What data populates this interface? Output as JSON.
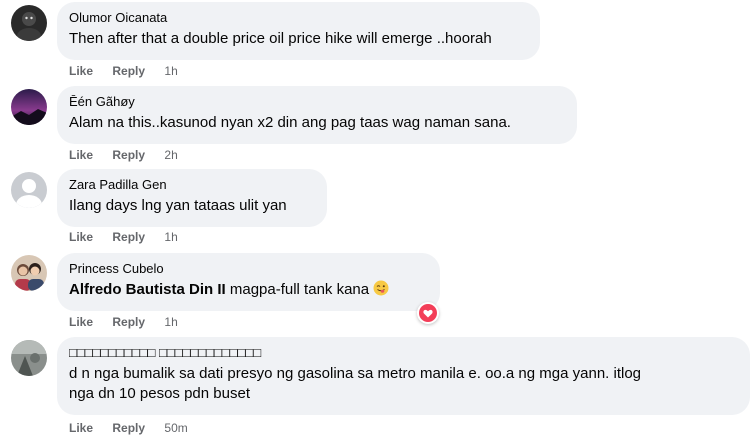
{
  "comments": [
    {
      "author": "Olumor Oicanata",
      "text": "Then after that a double price oil price hike will emerge ..hoorah",
      "like": "Like",
      "reply": "Reply",
      "time": "1h",
      "avatar": "person-avatar-dark"
    },
    {
      "author": "Ēén Gãhøy",
      "text": "Alam na this..kasunod nyan x2 din ang pag taas wag naman sana.",
      "like": "Like",
      "reply": "Reply",
      "time": "2h",
      "avatar": "person-avatar-purple-sky"
    },
    {
      "author": "Zara Padilla Gen",
      "text": "Ilang days lng yan tataas ulit yan",
      "like": "Like",
      "reply": "Reply",
      "time": "1h",
      "avatar": "default-avatar-gray"
    },
    {
      "author": "Princess Cubelo",
      "mention": "Alfredo Bautista Din II",
      "text": " magpa-full tank kana",
      "like": "Like",
      "reply": "Reply",
      "time": "1h",
      "avatar": "person-avatar-couple",
      "emoji": "winking-face-with-tongue-emoji",
      "reaction": "love-reaction-icon"
    },
    {
      "author": "□□□□□□□□□□□ □□□□□□□□□□□□□",
      "text_line1": "d n nga bumalik sa dati presyo ng gasolina sa metro manila e. oo.a ng mga yann. itlog",
      "text_line2": "nga dn 10 pesos pdn buset",
      "like": "Like",
      "reply": "Reply",
      "time": "50m",
      "avatar": "person-avatar-gray-photo"
    }
  ],
  "colors": {
    "bubble": "#f0f2f5",
    "meta": "#65676b",
    "text": "#050505",
    "love": "#f33e58"
  }
}
